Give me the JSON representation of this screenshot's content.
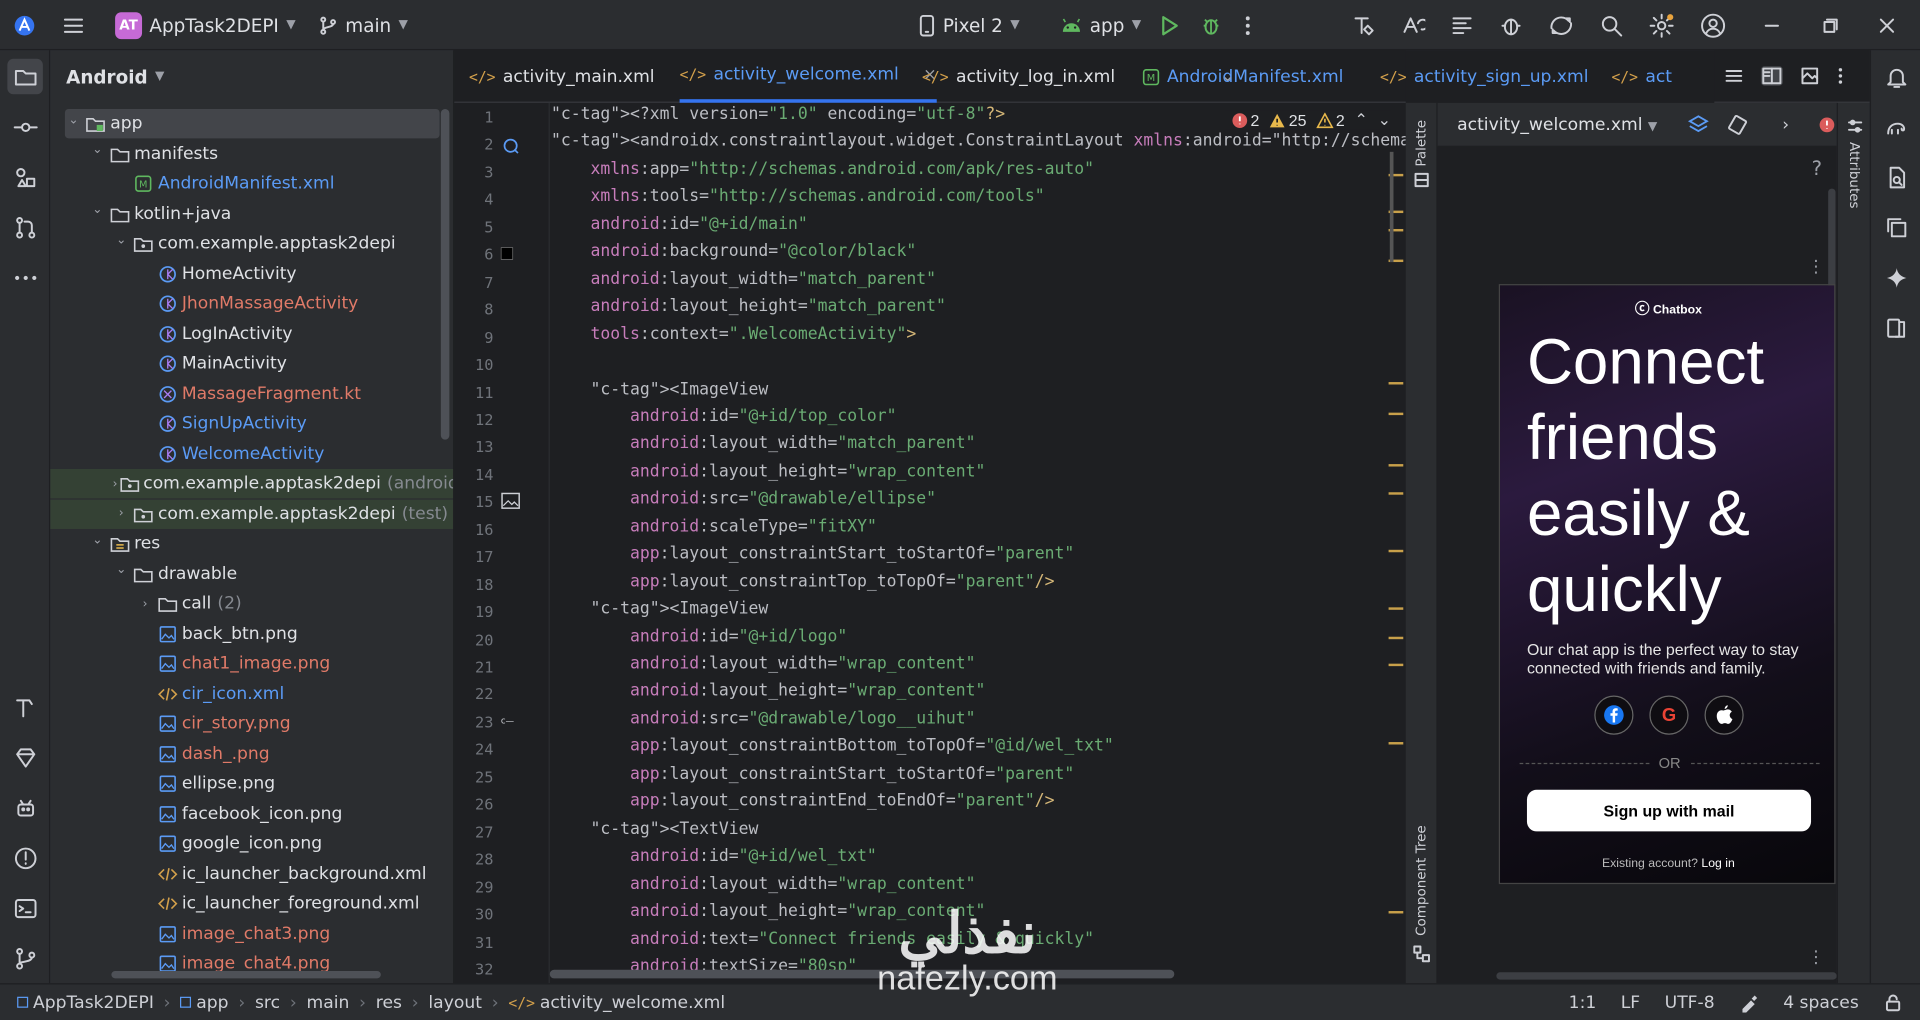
{
  "titlebar": {
    "project_badge": "AT",
    "project_name": "AppTask2DEPI",
    "branch": "main",
    "device": "Pixel 2",
    "run_config": "app"
  },
  "project_panel": {
    "view_mode": "Android",
    "tree": [
      {
        "label": "app",
        "level": 0,
        "expanded": true,
        "icon": "module-folder-icon",
        "selected": true
      },
      {
        "label": "manifests",
        "level": 1,
        "expanded": true,
        "icon": "folder-icon"
      },
      {
        "label": "AndroidManifest.xml",
        "level": 2,
        "icon": "manifest-icon",
        "color": "blue"
      },
      {
        "label": "kotlin+java",
        "level": 1,
        "expanded": true,
        "icon": "folder-icon"
      },
      {
        "label": "com.example.apptask2depi",
        "level": 2,
        "expanded": true,
        "icon": "package-icon"
      },
      {
        "label": "HomeActivity",
        "level": 3,
        "icon": "kotlin-class-icon"
      },
      {
        "label": "JhonMassageActivity",
        "level": 3,
        "icon": "kotlin-class-icon",
        "color": "red"
      },
      {
        "label": "LogInActivity",
        "level": 3,
        "icon": "kotlin-class-icon"
      },
      {
        "label": "MainActivity",
        "level": 3,
        "icon": "kotlin-class-icon"
      },
      {
        "label": "MassageFragment.kt",
        "level": 3,
        "icon": "kotlin-file-icon",
        "color": "red"
      },
      {
        "label": "SignUpActivity",
        "level": 3,
        "icon": "kotlin-class-icon",
        "color": "blue"
      },
      {
        "label": "WelcomeActivity",
        "level": 3,
        "icon": "kotlin-class-icon",
        "color": "blue"
      },
      {
        "label": "com.example.apptask2depi",
        "suffix": "(androidT",
        "level": 2,
        "expanded": false,
        "icon": "package-icon",
        "highlight": true
      },
      {
        "label": "com.example.apptask2depi",
        "suffix": "(test)",
        "level": 2,
        "expanded": false,
        "icon": "package-icon",
        "highlight": true
      },
      {
        "label": "res",
        "level": 1,
        "expanded": true,
        "icon": "res-folder-icon"
      },
      {
        "label": "drawable",
        "level": 2,
        "expanded": true,
        "icon": "folder-icon"
      },
      {
        "label": "call",
        "suffix": "(2)",
        "level": 3,
        "expanded": false,
        "icon": "folder-icon"
      },
      {
        "label": "back_btn.png",
        "level": 3,
        "icon": "image-file-icon"
      },
      {
        "label": "chat1_image.png",
        "level": 3,
        "icon": "image-file-icon",
        "color": "red"
      },
      {
        "label": "cir_icon.xml",
        "level": 3,
        "icon": "xml-file-icon",
        "color": "blue"
      },
      {
        "label": "cir_story.png",
        "level": 3,
        "icon": "image-file-icon",
        "color": "red"
      },
      {
        "label": "dash_.png",
        "level": 3,
        "icon": "image-file-icon",
        "color": "red"
      },
      {
        "label": "ellipse.png",
        "level": 3,
        "icon": "image-file-icon"
      },
      {
        "label": "facebook_icon.png",
        "level": 3,
        "icon": "image-file-icon"
      },
      {
        "label": "google_icon.png",
        "level": 3,
        "icon": "image-file-icon"
      },
      {
        "label": "ic_launcher_background.xml",
        "level": 3,
        "icon": "xml-file-icon"
      },
      {
        "label": "ic_launcher_foreground.xml",
        "level": 3,
        "icon": "xml-file-icon"
      },
      {
        "label": "image_chat3.png",
        "level": 3,
        "icon": "image-file-icon",
        "color": "red"
      },
      {
        "label": "image_chat4.png",
        "level": 3,
        "icon": "image-file-icon",
        "color": "red"
      }
    ]
  },
  "tabs": [
    {
      "label": "activity_main.xml",
      "icon": "xml",
      "active": false
    },
    {
      "label": "activity_welcome.xml",
      "icon": "xml",
      "active": true,
      "color": "blue"
    },
    {
      "label": "activity_log_in.xml",
      "icon": "xml",
      "active": false
    },
    {
      "label": "AndroidManifest.xml",
      "icon": "manifest",
      "active": false,
      "color": "blue"
    },
    {
      "label": "activity_sign_up.xml",
      "icon": "xml",
      "active": false,
      "color": "blue"
    },
    {
      "label": "act",
      "icon": "xml",
      "active": false,
      "color": "blue"
    }
  ],
  "inspections": {
    "errors": "2",
    "warnings": "25",
    "weak_warnings": "2"
  },
  "code": [
    "<?xml version=\"1.0\" encoding=\"utf-8\"?>",
    "<androidx.constraintlayout.widget.ConstraintLayout xmlns:android=\"http://schemas.andr",
    "    xmlns:app=\"http://schemas.android.com/apk/res-auto\"",
    "    xmlns:tools=\"http://schemas.android.com/tools\"",
    "    android:id=\"@+id/main\"",
    "    android:background=\"@color/black\"",
    "    android:layout_width=\"match_parent\"",
    "    android:layout_height=\"match_parent\"",
    "    tools:context=\".WelcomeActivity\">",
    "",
    "    <ImageView",
    "        android:id=\"@+id/top_color\"",
    "        android:layout_width=\"match_parent\"",
    "        android:layout_height=\"wrap_content\"",
    "        android:src=\"@drawable/ellipse\"",
    "        android:scaleType=\"fitXY\"",
    "        app:layout_constraintStart_toStartOf=\"parent\"",
    "        app:layout_constraintTop_toTopOf=\"parent\"/>",
    "    <ImageView",
    "        android:id=\"@+id/logo\"",
    "        android:layout_width=\"wrap_content\"",
    "        android:layout_height=\"wrap_content\"",
    "        android:src=\"@drawable/logo__uihut\"",
    "        app:layout_constraintBottom_toTopOf=\"@id/wel_txt\"",
    "        app:layout_constraintStart_toStartOf=\"parent\"",
    "        app:layout_constraintEnd_toEndOf=\"parent\"/>",
    "    <TextView",
    "        android:id=\"@+id/wel_txt\"",
    "        android:layout_width=\"wrap_content\"",
    "        android:layout_height=\"wrap_content\"",
    "        android:text=\"Connect friends easily & quickly\"",
    "        android:textSize=\"80sp\""
  ],
  "side_strips": {
    "palette": "Palette",
    "component_tree": "Component Tree",
    "attributes": "Attributes"
  },
  "design": {
    "file": "activity_welcome.xml",
    "help": "?",
    "preview": {
      "logo": "Chatbox",
      "title": "Connect friends easily & quickly",
      "subtitle": "Our chat app is the perfect way to stay connected with friends and family.",
      "social": [
        "facebook",
        "google",
        "apple"
      ],
      "or": "OR",
      "button": "Sign up with mail",
      "footer_text": "Existing account?",
      "footer_link": "Log in"
    }
  },
  "status": {
    "breadcrumb": [
      "AppTask2DEPI",
      "app",
      "src",
      "main",
      "res",
      "layout",
      "activity_welcome.xml"
    ],
    "position": "1:1",
    "line_sep": "LF",
    "encoding": "UTF-8",
    "indent": "4 spaces"
  },
  "watermark": {
    "arabic": "نفذلي",
    "latin": "nafezly.com"
  }
}
